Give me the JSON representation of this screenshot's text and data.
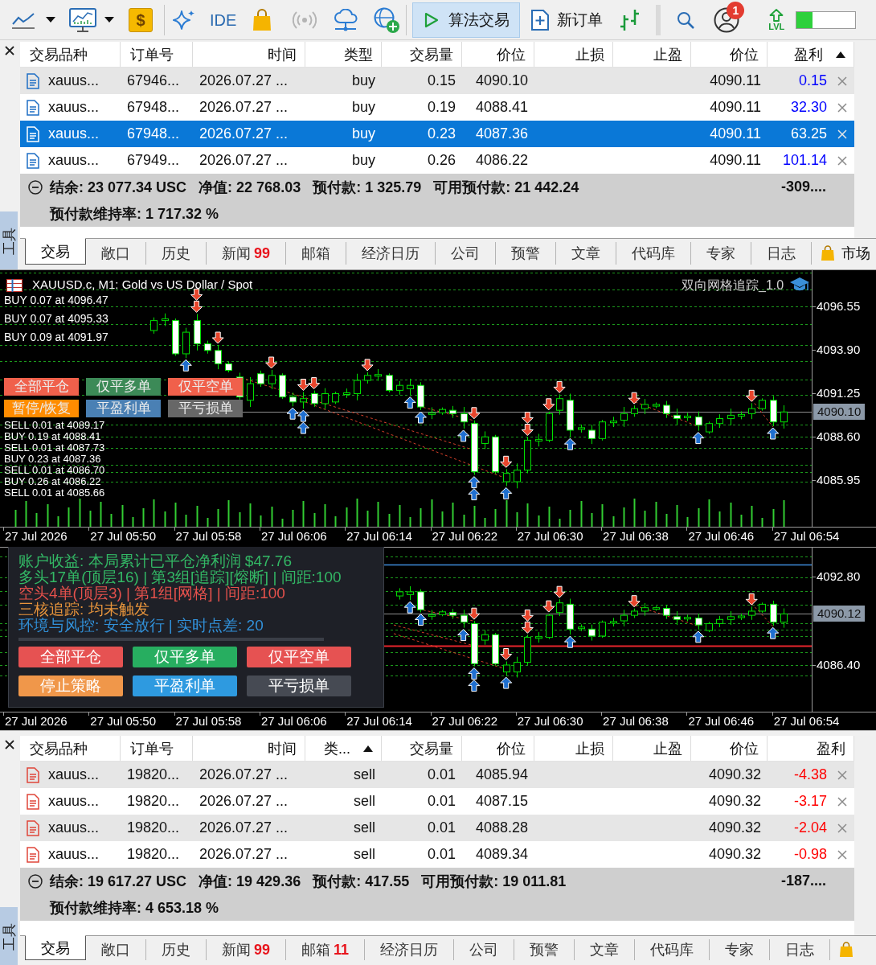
{
  "toolbar": {
    "currency_symbol": "$",
    "ide_label": "IDE",
    "signals": {
      "disabled": true
    },
    "algo_trading": {
      "label": "算法交易",
      "on": true
    },
    "new_order": {
      "label": "新订单"
    },
    "notifications": {
      "count": "1"
    },
    "level_badge": {
      "label": "LVL"
    },
    "level_meter": {
      "level": 0.27
    }
  },
  "top_panel": {
    "side_label": "工具",
    "table": {
      "columns": [
        {
          "label": "交易品种",
          "sorted": false
        },
        {
          "label": "订单号",
          "sorted": false
        },
        {
          "label": "时间",
          "sorted": false
        },
        {
          "label": "类型",
          "sorted": false
        },
        {
          "label": "交易量",
          "sorted": false
        },
        {
          "label": "价位",
          "sorted": false
        },
        {
          "label": "止损",
          "sorted": false
        },
        {
          "label": "止盈",
          "sorted": false
        },
        {
          "label": "价位",
          "sorted": false
        },
        {
          "label": "盈利",
          "sorted": true
        }
      ],
      "rows": [
        {
          "kind": "buy",
          "selected": false,
          "symbol": "xauus...",
          "ticket": "67946...",
          "time": "2026.07.27 ...",
          "type": "buy",
          "volume": "0.15",
          "price": "4090.10",
          "current_price": "4090.11",
          "profit": "0.15",
          "color": "#0000ff"
        },
        {
          "kind": "buy",
          "selected": false,
          "symbol": "xauus...",
          "ticket": "67948...",
          "time": "2026.07.27 ...",
          "type": "buy",
          "volume": "0.19",
          "price": "4088.41",
          "current_price": "4090.11",
          "profit": "32.30",
          "color": "#0000ff"
        },
        {
          "kind": "buy",
          "selected": true,
          "symbol": "xauus...",
          "ticket": "67948...",
          "time": "2026.07.27 ...",
          "type": "buy",
          "volume": "0.23",
          "price": "4087.36",
          "current_price": "4090.11",
          "profit": "63.25"
        },
        {
          "kind": "buy",
          "selected": false,
          "symbol": "xauus...",
          "ticket": "67949...",
          "time": "2026.07.27 ...",
          "type": "buy",
          "volume": "0.26",
          "price": "4086.22",
          "current_price": "4090.11",
          "profit": "101.14",
          "color": "#0000ff"
        }
      ]
    },
    "summary": {
      "expanded": true,
      "items": [
        "结余: 23 077.34 USC",
        "净值: 22 768.03",
        "预付款: 1 325.79",
        "可用预付款: 21 442.24"
      ],
      "total": "-309....",
      "margin_level": "预付款维持率: 1 717.32 %"
    },
    "tabs": [
      {
        "label": "交易",
        "selected": true
      },
      {
        "label": "敞口",
        "selected": false
      },
      {
        "label": "历史",
        "selected": false
      },
      {
        "label": "新闻",
        "badge": "99",
        "selected": false
      },
      {
        "label": "邮箱",
        "selected": false
      },
      {
        "label": "经济日历",
        "selected": false
      },
      {
        "label": "公司",
        "selected": false
      },
      {
        "label": "预警",
        "selected": false
      },
      {
        "label": "文章",
        "selected": false
      },
      {
        "label": "代码库",
        "selected": false
      },
      {
        "label": "专家",
        "selected": false
      },
      {
        "label": "日志",
        "selected": false
      }
    ],
    "market_tab": {
      "label": "市场"
    }
  },
  "chart_1": {
    "title": "XAUUSD.c, M1: Gold vs US Dollar / Spot",
    "indicator": "双向网格追踪_1.0",
    "trade_labels_upper": [
      "BUY 0.07 at 4096.47",
      "BUY 0.07 at 4095.33",
      "BUY 0.09 at 4091.97"
    ],
    "buttons": [
      {
        "label": "全部平仓",
        "color": "#f0604b"
      },
      {
        "label": "仅平多单",
        "color": "#3c8a57"
      },
      {
        "label": "仅平空单",
        "color": "#f0604b"
      },
      {
        "label": "暂停/恢复",
        "color": "#ff8c00"
      },
      {
        "label": "平盈利单",
        "color": "#4a80b4"
      },
      {
        "label": "平亏损单",
        "color": "#676767"
      }
    ],
    "trade_labels_lower": [
      "SELL 0.01 at 4089.17",
      "BUY 0.19 at 4088.41",
      "SELL 0.01 at 4087.73",
      "BUY 0.23 at 4087.36",
      "SELL 0.01 at 4086.70",
      "BUY 0.26 at 4086.22",
      "SELL 0.01 at 4085.66"
    ],
    "price_labels": [
      "4096.55",
      "4093.90",
      "4091.25",
      "4088.60",
      "4085.95"
    ],
    "current_price": "4090.10",
    "time_labels": [
      "27 Jul 2026",
      "27 Jul 05:50",
      "27 Jul 05:58",
      "27 Jul 06:06",
      "27 Jul 06:14",
      "27 Jul 06:22",
      "27 Jul 06:30",
      "27 Jul 06:38",
      "27 Jul 06:46",
      "27 Jul 06:54"
    ]
  },
  "chart_2": {
    "status_lines": [
      {
        "text": "账户收益: 本局累计已平仓净利润 $47.76",
        "color": "#33b865"
      },
      {
        "text": "多头17单(顶层16) | 第3组[追踪][熔断] | 间距:100",
        "color": "#33b865"
      },
      {
        "text": "空头4单(顶层3) | 第1组[网格] | 间距:100",
        "color": "#e5514c"
      },
      {
        "text": "三核追踪: 均未触发",
        "color": "#e8953c"
      },
      {
        "text": "环境与风控: 安全放行 | 实时点差: 20",
        "color": "#3190d8"
      }
    ],
    "buttons": [
      {
        "label": "全部平仓",
        "color": "#e65252"
      },
      {
        "label": "仅平多单",
        "color": "#27ae60"
      },
      {
        "label": "仅平空单",
        "color": "#e65252"
      },
      {
        "label": "停止策略",
        "color": "#f0974a"
      },
      {
        "label": "平盈利单",
        "color": "#2e9ae0"
      },
      {
        "label": "平亏损单",
        "color": "#464a53"
      }
    ],
    "price_labels": [
      "4092.80",
      "4086.40"
    ],
    "current_price": "4090.12",
    "time_labels": [
      "27 Jul 2026",
      "27 Jul 05:50",
      "27 Jul 05:58",
      "27 Jul 06:06",
      "27 Jul 06:14",
      "27 Jul 06:22",
      "27 Jul 06:30",
      "27 Jul 06:38",
      "27 Jul 06:46",
      "27 Jul 06:54"
    ]
  },
  "bottom_panel": {
    "side_label": "工具",
    "table": {
      "columns": [
        {
          "label": "交易品种",
          "sorted": false
        },
        {
          "label": "订单号",
          "sorted": false
        },
        {
          "label": "时间",
          "sorted": false
        },
        {
          "label": "类...",
          "sorted": true
        },
        {
          "label": "交易量",
          "sorted": false
        },
        {
          "label": "价位",
          "sorted": false
        },
        {
          "label": "止损",
          "sorted": false
        },
        {
          "label": "止盈",
          "sorted": false
        },
        {
          "label": "价位",
          "sorted": false
        },
        {
          "label": "盈利",
          "sorted": false
        }
      ],
      "rows": [
        {
          "kind": "sell",
          "selected": false,
          "symbol": "xauus...",
          "ticket": "19820...",
          "time": "2026.07.27 ...",
          "type": "sell",
          "volume": "0.01",
          "price": "4085.94",
          "current_price": "4090.32",
          "profit": "-4.38",
          "color": "#ff0000"
        },
        {
          "kind": "sell",
          "selected": false,
          "symbol": "xauus...",
          "ticket": "19820...",
          "time": "2026.07.27 ...",
          "type": "sell",
          "volume": "0.01",
          "price": "4087.15",
          "current_price": "4090.32",
          "profit": "-3.17",
          "color": "#ff0000"
        },
        {
          "kind": "sell",
          "selected": false,
          "symbol": "xauus...",
          "ticket": "19820...",
          "time": "2026.07.27 ...",
          "type": "sell",
          "volume": "0.01",
          "price": "4088.28",
          "current_price": "4090.32",
          "profit": "-2.04",
          "color": "#ff0000"
        },
        {
          "kind": "sell",
          "selected": false,
          "symbol": "xauus...",
          "ticket": "19820...",
          "time": "2026.07.27 ...",
          "type": "sell",
          "volume": "0.01",
          "price": "4089.34",
          "current_price": "4090.32",
          "profit": "-0.98",
          "color": "#ff0000"
        }
      ]
    },
    "summary": {
      "expanded": true,
      "items": [
        "结余: 19 617.27 USC",
        "净值: 19 429.36",
        "预付款: 417.55",
        "可用预付款: 19 011.81"
      ],
      "total": "-187....",
      "margin_level": "预付款维持率: 4 653.18 %"
    },
    "tabs": [
      {
        "label": "交易",
        "selected": true
      },
      {
        "label": "敞口",
        "selected": false
      },
      {
        "label": "历史",
        "selected": false
      },
      {
        "label": "新闻",
        "badge": "99",
        "selected": false
      },
      {
        "label": "邮箱",
        "badge": "11",
        "selected": false
      },
      {
        "label": "经济日历",
        "selected": false
      },
      {
        "label": "公司",
        "selected": false
      },
      {
        "label": "预警",
        "selected": false
      },
      {
        "label": "文章",
        "selected": false
      },
      {
        "label": "代码库",
        "selected": false
      },
      {
        "label": "专家",
        "selected": false
      },
      {
        "label": "日志",
        "selected": false
      }
    ]
  }
}
